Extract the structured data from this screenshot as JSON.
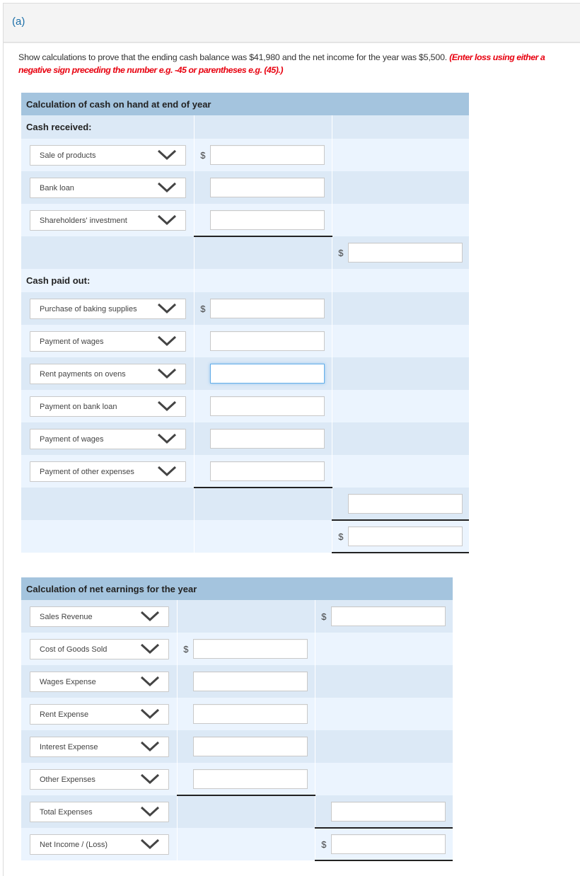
{
  "part_label": "(a)",
  "instructions": {
    "text": "Show calculations to prove that the ending cash balance was $41,980 and the net income for the year was $5,500.",
    "hint": "(Enter loss using either a negative sign preceding the number e.g. -45 or parentheses e.g. (45).)"
  },
  "currency_symbol": "$",
  "cash_table": {
    "title": "Calculation of cash on hand at end of year",
    "received_heading": "Cash received:",
    "received_items": [
      {
        "label": "Sale of products",
        "value": ""
      },
      {
        "label": "Bank loan",
        "value": ""
      },
      {
        "label": "Shareholders' investment",
        "value": ""
      }
    ],
    "received_total": "",
    "paid_heading": "Cash paid out:",
    "paid_items": [
      {
        "label": "Purchase of baking supplies",
        "value": ""
      },
      {
        "label": "Payment of wages",
        "value": ""
      },
      {
        "label": "Rent payments on ovens",
        "value": "",
        "focused": true
      },
      {
        "label": "Payment on bank loan",
        "value": ""
      },
      {
        "label": "Payment of wages",
        "value": ""
      },
      {
        "label": "Payment of other expenses",
        "value": ""
      }
    ],
    "paid_total": "",
    "ending_cash": ""
  },
  "earnings_table": {
    "title": "Calculation of net earnings for the year",
    "rows": [
      {
        "label": "Sales Revenue",
        "value": ""
      },
      {
        "label": "Cost of Goods Sold",
        "value": ""
      },
      {
        "label": "Wages Expense",
        "value": ""
      },
      {
        "label": "Rent Expense",
        "value": ""
      },
      {
        "label": "Interest Expense",
        "value": ""
      },
      {
        "label": "Other Expenses",
        "value": ""
      },
      {
        "label": "Total Expenses",
        "value": ""
      },
      {
        "label": "Net Income / (Loss)",
        "value": ""
      }
    ]
  },
  "icons": {
    "dropdown": "chevron-down-icon"
  }
}
